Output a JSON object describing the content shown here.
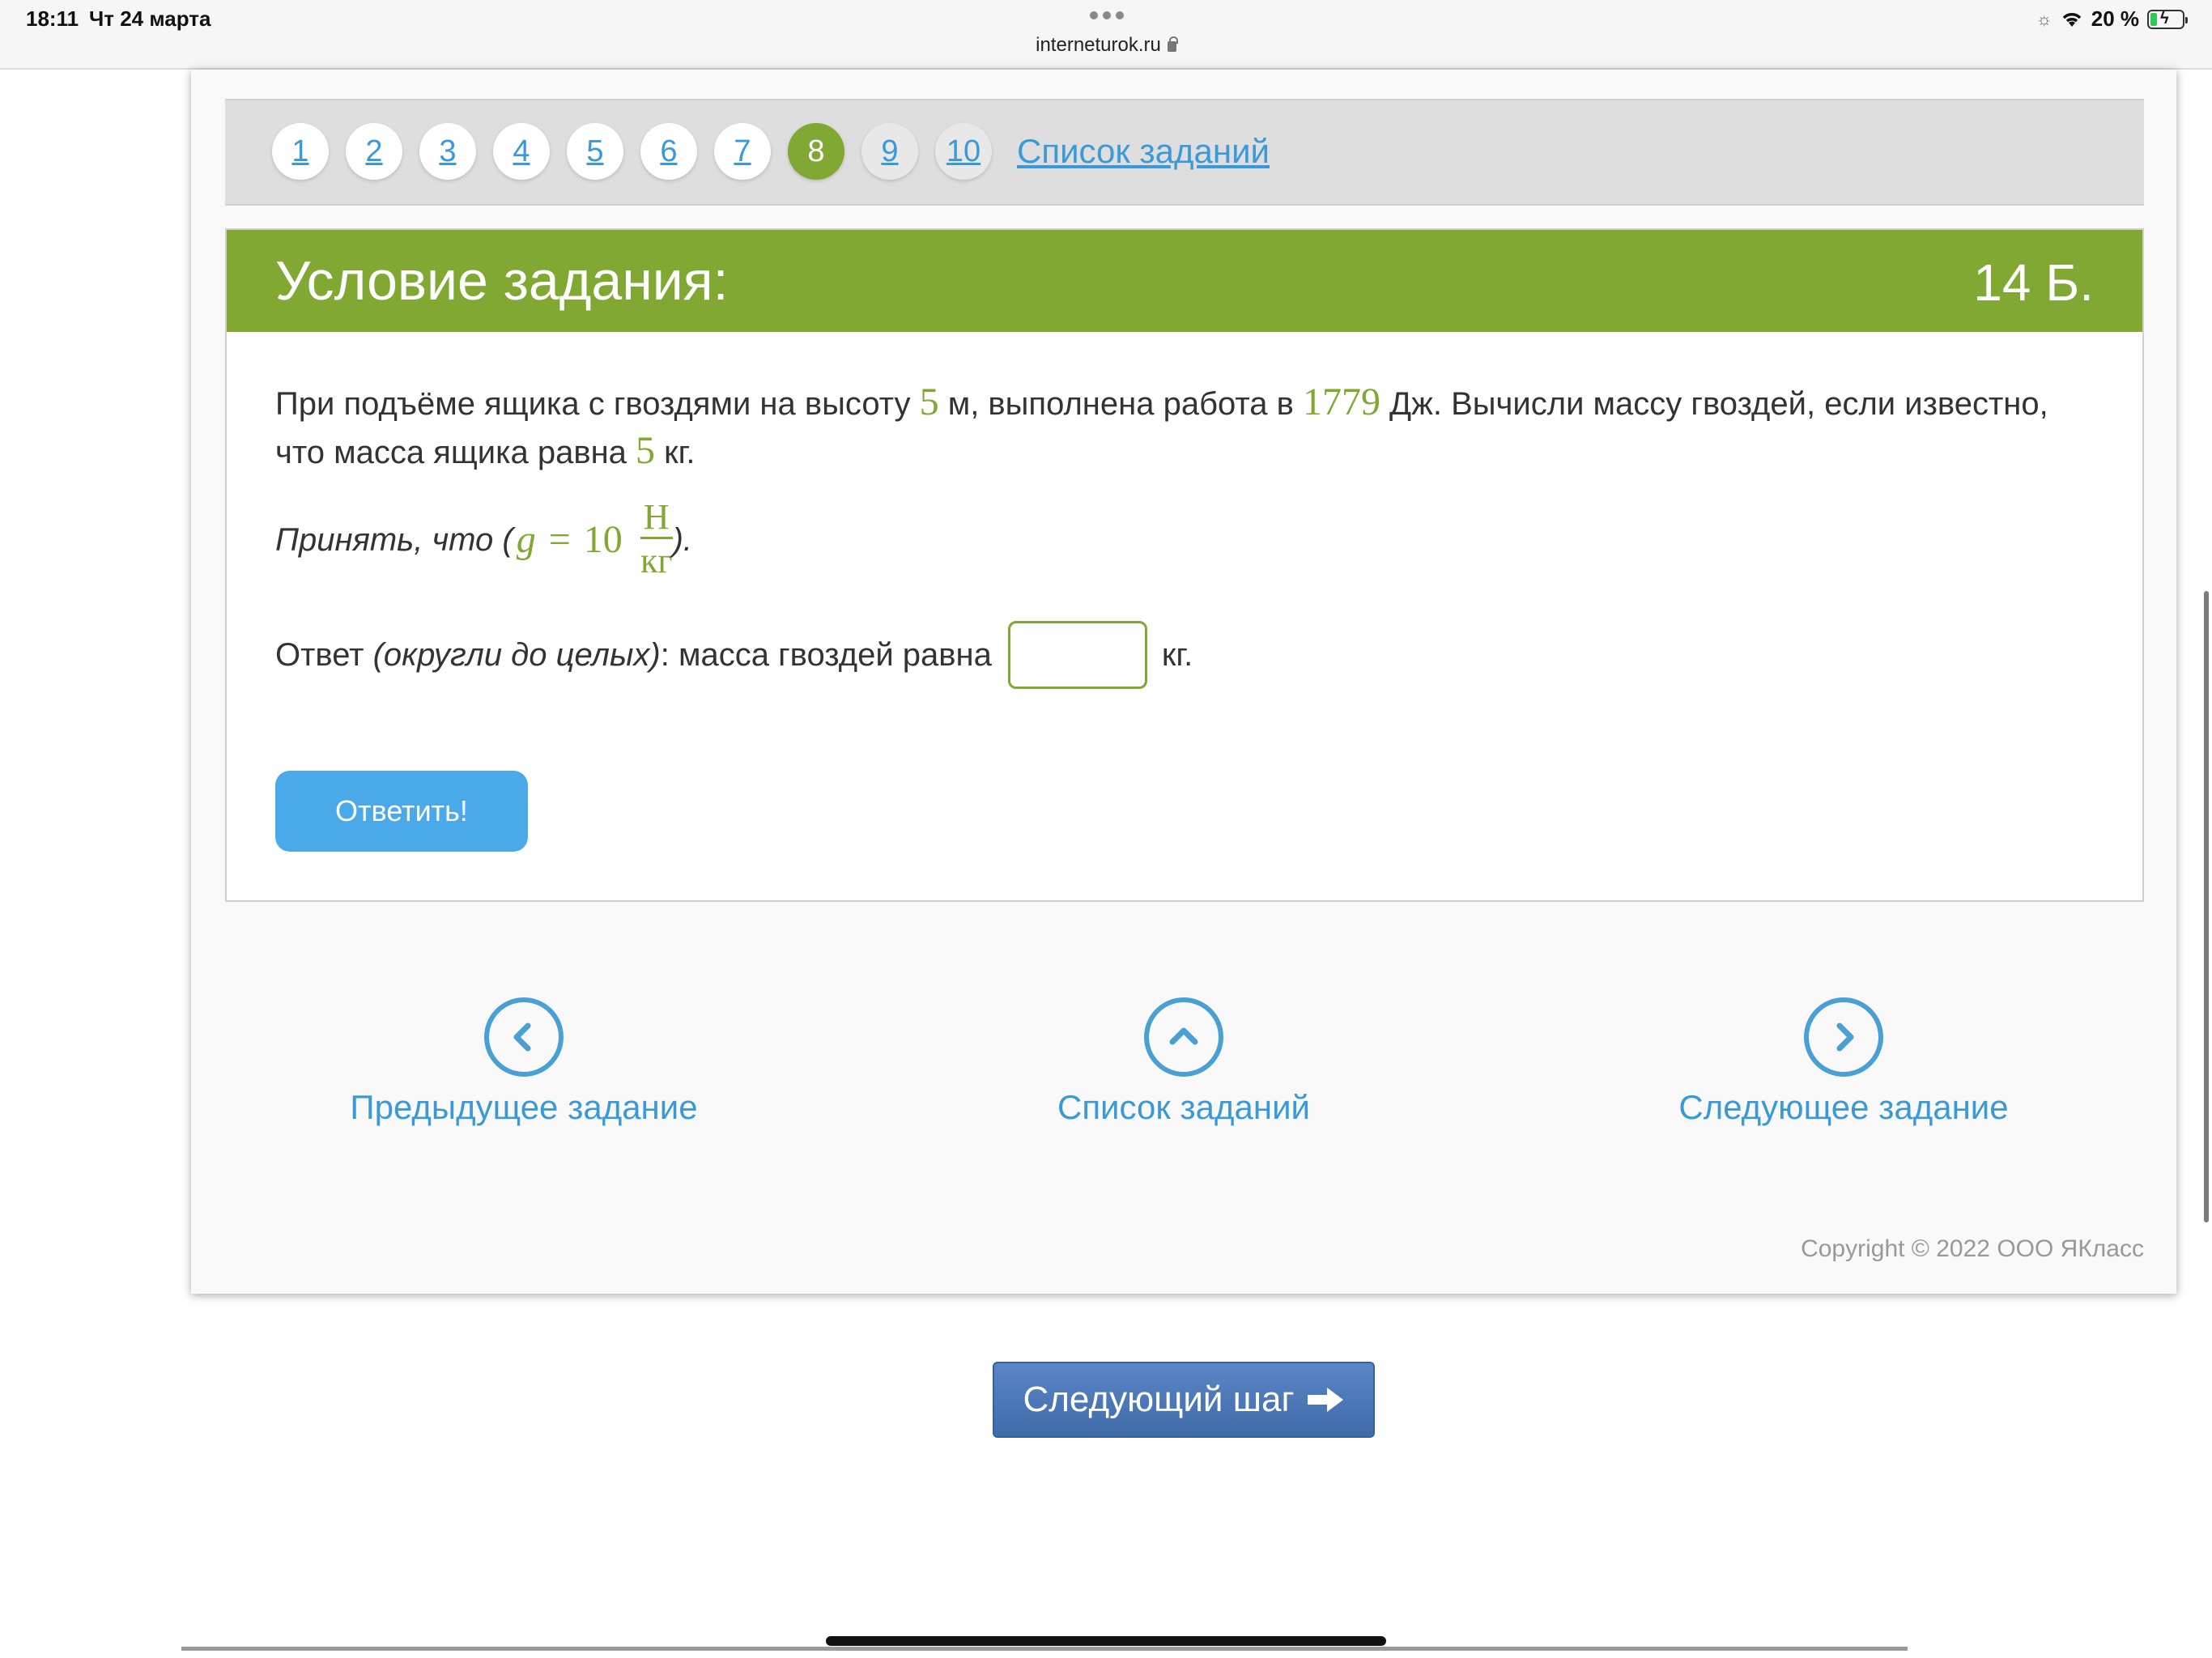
{
  "status_bar": {
    "time": "18:11",
    "date": "Чт 24 марта",
    "url": "interneturok.ru",
    "battery": "20 %",
    "battery_level": 0.2
  },
  "pager": {
    "pages": [
      "1",
      "2",
      "3",
      "4",
      "5",
      "6",
      "7",
      "8",
      "9",
      "10"
    ],
    "active_page": "8",
    "tasks_link": "Список заданий"
  },
  "task": {
    "title": "Условие задания:",
    "points": "14 Б.",
    "text_1": "При подъёме ящика с гвоздями на высоту ",
    "height_value": "5",
    "text_2": " м, выполнена работа в ",
    "work_value": "1779",
    "text_3": " Дж. Вычисли массу гвоздей, если известно, что масса ящика равна ",
    "box_mass_value": "5",
    "text_4": " кг.",
    "hint_prefix": "Принять, что (",
    "hint_var": "g",
    "hint_eq": "=",
    "hint_num": "10",
    "hint_unit_top": "Н",
    "hint_unit_bottom": "кг",
    "hint_suffix": ").",
    "answer_prefix": "Ответ ",
    "answer_italic": "(округли до целых)",
    "answer_text": ": масса гвоздей равна",
    "answer_unit": "кг.",
    "answer_value": "",
    "submit_label": "Ответить!"
  },
  "navigation": {
    "prev_label": "Предыдущее задание",
    "list_label": "Список заданий",
    "next_label": "Следующее задание"
  },
  "footer": {
    "copyright": "Copyright © 2022 ООО ЯКласс",
    "next_step_label": "Следующий шаг"
  },
  "colors": {
    "accent_green": "#80a833",
    "link_blue": "#3a9ad9",
    "button_blue": "#4aaae9",
    "next_step_blue": "#4a76b6"
  }
}
